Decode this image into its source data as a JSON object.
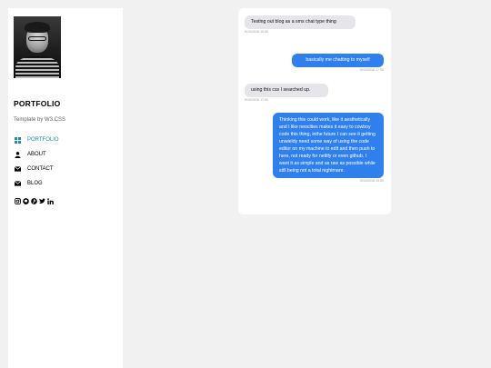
{
  "sidebar": {
    "brand": "PORTFOLIO",
    "subtitle": "Template by W3.CSS",
    "nav": [
      {
        "label": "PORTFOLIO",
        "icon": "grid-icon",
        "active": true
      },
      {
        "label": "ABOUT",
        "icon": "user-icon",
        "active": false
      },
      {
        "label": "CONTACT",
        "icon": "envelope-icon",
        "active": false
      },
      {
        "label": "BLOG",
        "icon": "envelope-icon",
        "active": false
      }
    ],
    "social_icons": [
      "instagram-icon",
      "github-icon",
      "pinterest-icon",
      "twitter-icon",
      "linkedin-icon"
    ]
  },
  "chat": {
    "messages": [
      {
        "from": "in",
        "text": "Testing out blog as a sms chat type thing",
        "time": "9/10/2016 10:00"
      },
      {
        "from": "out",
        "text": "basically me chatting to myself",
        "time": "9/10/2016 17:00"
      },
      {
        "from": "in",
        "text": "using this css I searched up.",
        "time": "9/10/2016 17:00"
      },
      {
        "from": "out",
        "text": "Thinking this could work, like it aesthetically and I like neocities makes it easy to cowboy code this thing, inthe future I can see it getting unwieldy need some way of using the code editor on my machine to edit and then push to here, not ready for netlify or even github. I want it as simple and as raw as possible while still being not a total nightmare.",
        "time": "9/10/2016 19:00"
      }
    ]
  },
  "colors": {
    "accent": "#1a8aa6",
    "outgoing_bubble": "#2f80ed",
    "incoming_bubble": "#e5e5ea",
    "page_bg": "#f1f1f1"
  }
}
